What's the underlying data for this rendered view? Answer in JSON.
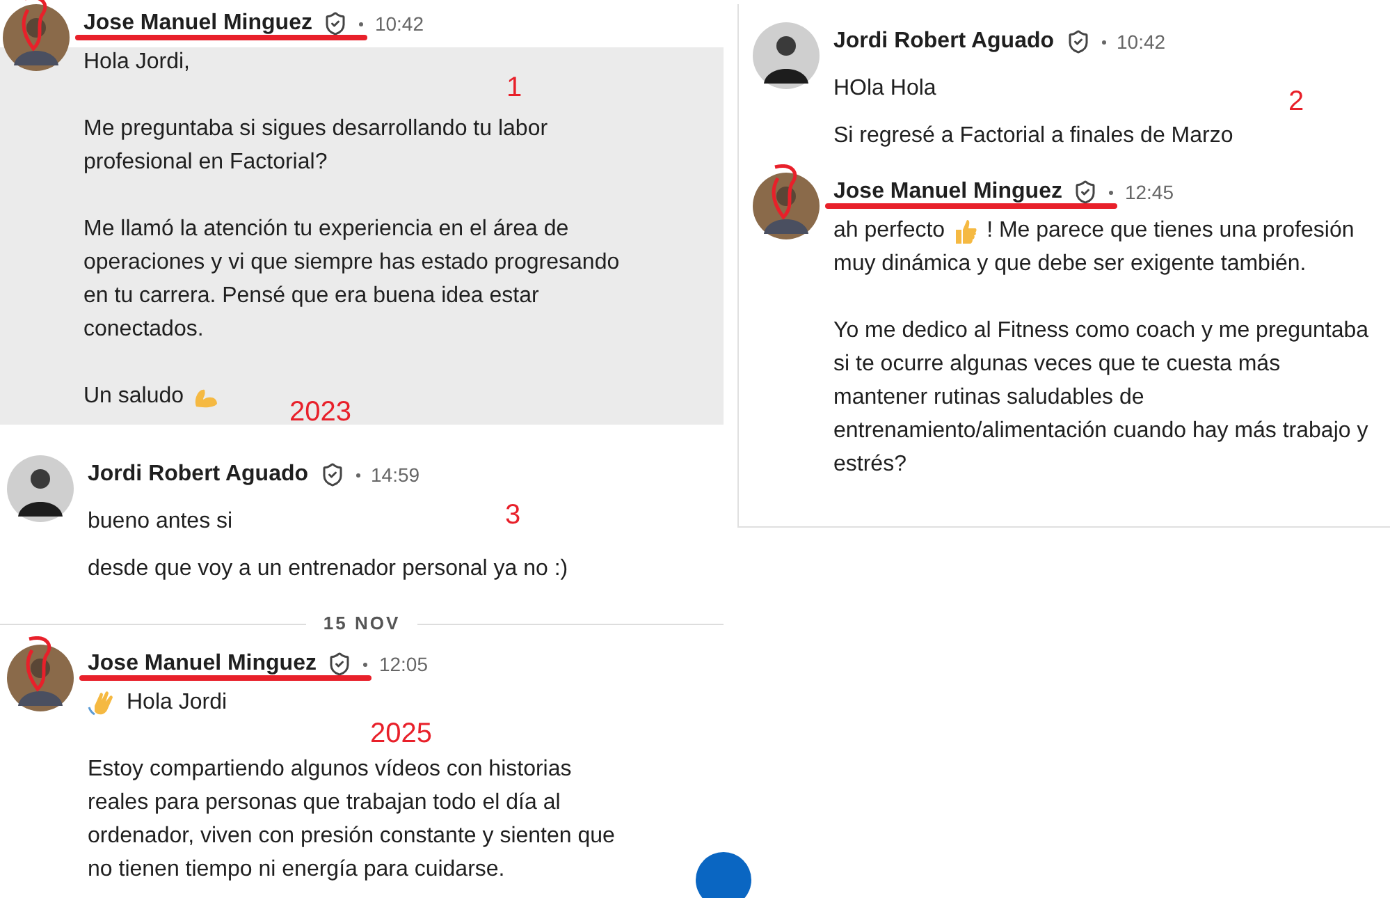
{
  "panels": [
    {
      "highlighted": true,
      "annotation": "1",
      "year": "2023",
      "messages": [
        {
          "sender": "Jose Manuel Minguez",
          "redacted": true,
          "time": "10:42",
          "paragraphs": [
            [
              {
                "kind": "text",
                "text": "Hola Jordi,"
              }
            ],
            [
              {
                "kind": "text",
                "text": "Me preguntaba si sigues desarrollando tu labor profesional en Factorial?"
              }
            ],
            [
              {
                "kind": "text",
                "text": "Me llamó la atención tu experiencia en el área de operaciones y vi que siempre has estado progresando en tu carrera. Pensé que era buena idea estar conectados."
              }
            ],
            [
              {
                "kind": "text",
                "text": "Un saludo"
              },
              {
                "kind": "biceps"
              }
            ]
          ]
        }
      ]
    },
    {
      "highlighted": false,
      "annotation": "3",
      "messages": [
        {
          "sender": "Jordi Robert Aguado",
          "redacted": false,
          "time": "14:59",
          "lines": [
            "bueno antes si",
            "desde que voy a un entrenador personal ya no :)"
          ]
        }
      ]
    },
    {
      "highlighted": false,
      "date": "15 NOV",
      "year": "2025",
      "messages": [
        {
          "sender": "Jose Manuel Minguez",
          "redacted": true,
          "time": "12:05",
          "paragraphs": [
            [
              {
                "kind": "wave"
              },
              {
                "kind": "text",
                "text": "Hola Jordi"
              }
            ],
            [
              {
                "kind": "text",
                "text": "Estoy compartiendo algunos vídeos con historias reales para personas que trabajan todo el día al ordenador, viven con presión constante y sienten que no tienen tiempo ni energía para cuidarse."
              }
            ]
          ]
        }
      ]
    },
    {
      "highlighted": false,
      "annotation": "2",
      "messages": [
        {
          "sender": "Jordi Robert Aguado",
          "redacted": false,
          "time": "10:42",
          "lines": [
            "HOla Hola",
            "Si regresé a Factorial a finales de Marzo"
          ]
        },
        {
          "sender": "Jose Manuel Minguez",
          "redacted": true,
          "time": "12:45",
          "paragraphs": [
            [
              {
                "kind": "text",
                "text": "ah perfecto"
              },
              {
                "kind": "thumbs-up"
              },
              {
                "kind": "text",
                "text": "! Me parece que tienes una profesión"
              },
              {
                "kind": "text",
                "text": "muy dinámica y que debe ser exigente también."
              }
            ],
            [
              {
                "kind": "text",
                "text": "Yo me dedico al Fitness como coach y me preguntaba si te ocurre algunas veces que te cuesta más mantener rutinas saludables de entrenamiento/alimentación cuando hay más trabajo y estrés?"
              }
            ]
          ]
        }
      ]
    }
  ]
}
